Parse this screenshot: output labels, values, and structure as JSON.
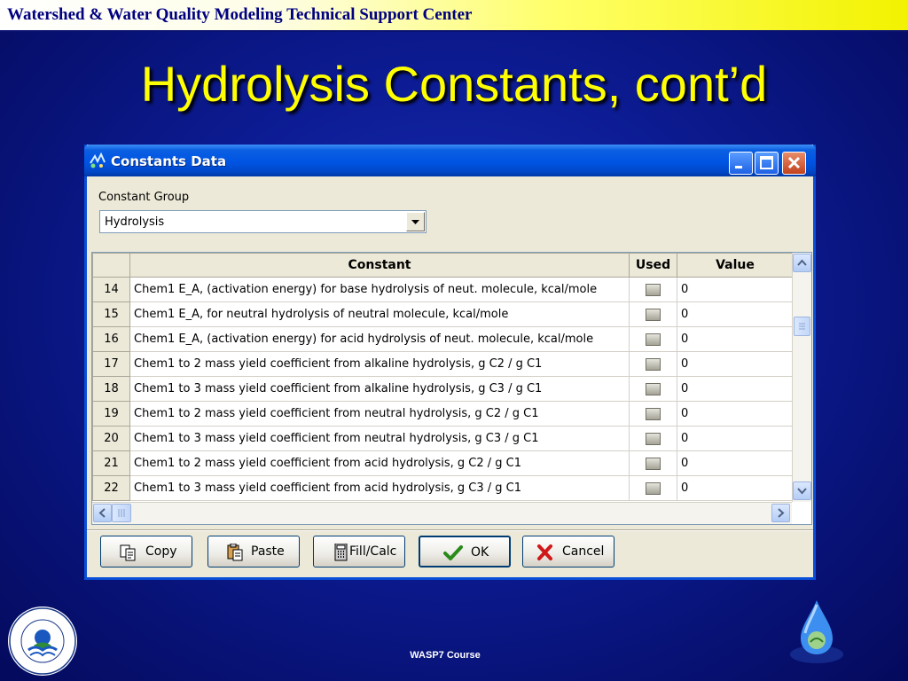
{
  "header": {
    "title": "Watershed & Water Quality Modeling Technical Support Center"
  },
  "slide": {
    "title": "Hydrolysis Constants, cont’d",
    "footer": "WASP7 Course"
  },
  "window": {
    "title": "Constants Data",
    "constant_group_label": "Constant Group",
    "constant_group_value": "Hydrolysis",
    "columns": {
      "constant": "Constant",
      "used": "Used",
      "value": "Value"
    },
    "rows": [
      {
        "num": "14",
        "constant": "Chem1 E_A, (activation energy) for base hydrolysis of neut. molecule, kcal/mole",
        "used": false,
        "value": "0"
      },
      {
        "num": "15",
        "constant": "Chem1 E_A, for neutral hydrolysis of neutral molecule, kcal/mole",
        "used": false,
        "value": "0"
      },
      {
        "num": "16",
        "constant": "Chem1 E_A, (activation energy) for acid hydrolysis of neut. molecule, kcal/mole",
        "used": false,
        "value": "0"
      },
      {
        "num": "17",
        "constant": "Chem1 to 2 mass yield coefficient from alkaline hydrolysis, g C2 / g C1",
        "used": false,
        "value": "0"
      },
      {
        "num": "18",
        "constant": "Chem1 to 3 mass yield coefficient from alkaline hydrolysis, g C3 / g C1",
        "used": false,
        "value": "0"
      },
      {
        "num": "19",
        "constant": "Chem1 to 2 mass yield coefficient from neutral hydrolysis, g C2 / g C1",
        "used": false,
        "value": "0"
      },
      {
        "num": "20",
        "constant": "Chem1 to 3 mass yield coefficient from neutral hydrolysis, g C3 / g C1",
        "used": false,
        "value": "0"
      },
      {
        "num": "21",
        "constant": "Chem1 to 2 mass yield coefficient from acid hydrolysis, g C2 / g C1",
        "used": false,
        "value": "0"
      },
      {
        "num": "22",
        "constant": "Chem1 to 3 mass yield coefficient from acid hydrolysis, g C3 / g C1",
        "used": false,
        "value": "0"
      }
    ],
    "buttons": {
      "copy": "Copy",
      "paste": "Paste",
      "fill_calc": "Fill/Calc",
      "ok": "OK",
      "cancel": "Cancel"
    }
  },
  "logos": {
    "epa_ring_text": "UNITED STATES • ENVIRONMENTAL PROTECTION AGENCY"
  },
  "colors": {
    "background": "#0c1b92",
    "title": "#ffff00",
    "titlebar": "#0054e3",
    "dialog": "#ece9d8"
  }
}
